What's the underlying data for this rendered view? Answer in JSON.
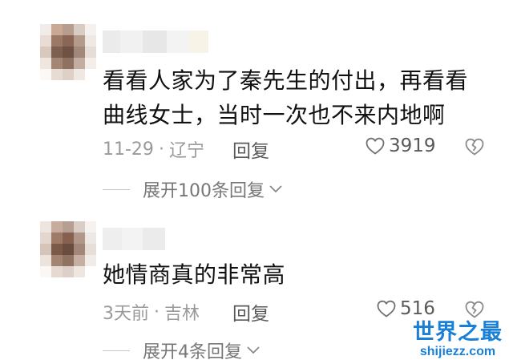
{
  "comments": [
    {
      "text_lines": [
        "看看人家为了秦先生的付出，再看看",
        "曲线女士，当时一次也不来内地啊"
      ],
      "date": "11-29",
      "dot": "·",
      "location": "辽宁",
      "reply_label": "回复",
      "likes": "3919",
      "expand_label": "展开100条回复"
    },
    {
      "text_lines": [
        "她情商真的非常高"
      ],
      "date": "3天前",
      "dot": "·",
      "location": "吉林",
      "reply_label": "回复",
      "likes": "516",
      "expand_label": "展开4条回复"
    }
  ],
  "icons": {
    "like": "heart-outline-icon",
    "dislike": "broken-heart-icon",
    "expand": "chevron-down-icon"
  },
  "watermark": {
    "title": "世界之最",
    "url": "shijiezz.com"
  },
  "colors": {
    "text": "#111111",
    "meta": "#9a9a9a",
    "accent": "#1a7fd6"
  }
}
